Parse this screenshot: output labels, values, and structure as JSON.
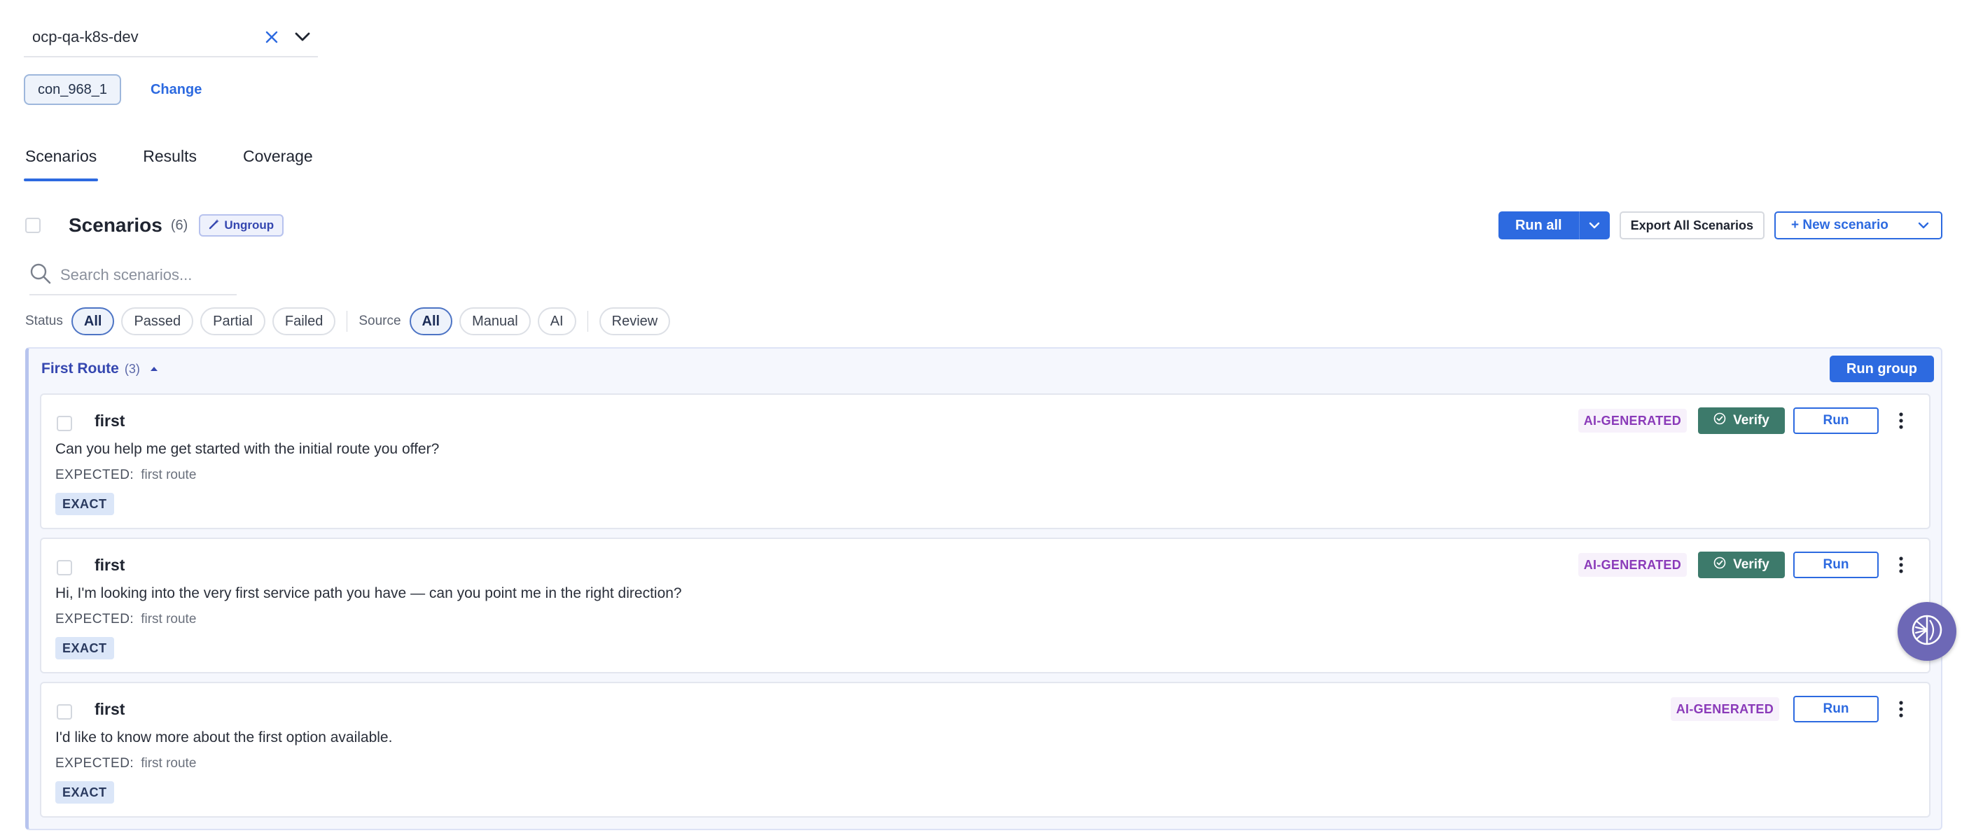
{
  "project": {
    "value": "ocp-qa-k8s-dev"
  },
  "connection": {
    "chip": "con_968_1",
    "change_label": "Change"
  },
  "tabs": [
    {
      "label": "Scenarios",
      "active": true
    },
    {
      "label": "Results",
      "active": false
    },
    {
      "label": "Coverage",
      "active": false
    }
  ],
  "header": {
    "title": "Scenarios",
    "count": "(6)",
    "ungroup_label": "Ungroup",
    "run_all_label": "Run all",
    "export_label": "Export All Scenarios",
    "new_scenario_label": "+ New scenario"
  },
  "search": {
    "placeholder": "Search scenarios..."
  },
  "filters": {
    "status_label": "Status",
    "status_options": [
      "All",
      "Passed",
      "Partial",
      "Failed"
    ],
    "source_label": "Source",
    "source_options": [
      "All",
      "Manual",
      "AI"
    ],
    "review_label": "Review"
  },
  "group": {
    "title": "First Route",
    "count": "(3)",
    "run_group_label": "Run group",
    "scenarios": [
      {
        "title": "first",
        "question": "Can you help me get started with the initial route you offer?",
        "expected_key": "EXPECTED:",
        "expected_value": "first route",
        "match": "EXACT",
        "source_badge": "AI-GENERATED",
        "verify_label": "Verify",
        "run_label": "Run"
      },
      {
        "title": "first",
        "question": "Hi, I'm looking into the very first service path you have — can you point me in the right direction?",
        "expected_key": "EXPECTED:",
        "expected_value": "first route",
        "match": "EXACT",
        "source_badge": "AI-GENERATED",
        "verify_label": "Verify",
        "run_label": "Run"
      },
      {
        "title": "first",
        "question": "I'd like to know more about the first option available.",
        "expected_key": "EXPECTED:",
        "expected_value": "first route",
        "match": "EXACT",
        "source_badge": "AI-GENERATED",
        "run_label": "Run"
      }
    ]
  },
  "colors": {
    "primary": "#2d6ae0",
    "verify": "#3d7a6b",
    "ai_badge_text": "#8a3ab9",
    "group_accent": "#3547b0"
  },
  "icons": {
    "clear": "close-icon",
    "dropdown": "chevron-down-icon",
    "ungroup": "magic-wand-icon",
    "search": "search-icon",
    "group_toggle": "caret-up-icon",
    "verify": "check-circle-icon",
    "more": "kebab-menu-icon",
    "assistant": "assistant-globe-icon"
  }
}
